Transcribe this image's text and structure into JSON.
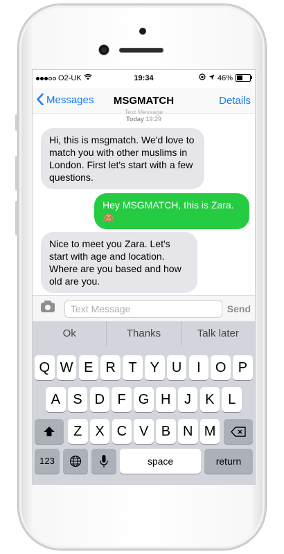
{
  "status_bar": {
    "carrier": "O2-UK",
    "time": "19:34",
    "battery": "46%",
    "battery_fraction": 0.46
  },
  "nav": {
    "back_label": "Messages",
    "title": "MSGMATCH",
    "details_label": "Details"
  },
  "timestamp": {
    "line1": "Text Message",
    "line2_bold": "Today",
    "line2_time": "19:29"
  },
  "messages": [
    {
      "direction": "incoming",
      "text": "Hi, this is msgmatch. We'd love to match you with other muslims in London. First let's start with a few questions."
    },
    {
      "direction": "outgoing",
      "text": "Hey MSGMATCH, this is Zara.",
      "emoji": "🙈"
    },
    {
      "direction": "incoming",
      "text": "Nice to meet you Zara. Let's start with age and location. Where are you based and how old are you."
    }
  ],
  "composer": {
    "placeholder": "Text Message",
    "send_label": "Send"
  },
  "suggestions": [
    "Ok",
    "Thanks",
    "Talk later"
  ],
  "keyboard": {
    "row1": [
      "Q",
      "W",
      "E",
      "R",
      "T",
      "Y",
      "U",
      "I",
      "O",
      "P"
    ],
    "row2": [
      "A",
      "S",
      "D",
      "F",
      "G",
      "H",
      "J",
      "K",
      "L"
    ],
    "row3": [
      "Z",
      "X",
      "C",
      "V",
      "B",
      "N",
      "M"
    ],
    "numbers_label": "123",
    "space_label": "space",
    "return_label": "return"
  },
  "colors": {
    "accent": "#137cf2",
    "outgoing_bubble": "#25cc42",
    "incoming_bubble": "#e5e5ea"
  }
}
